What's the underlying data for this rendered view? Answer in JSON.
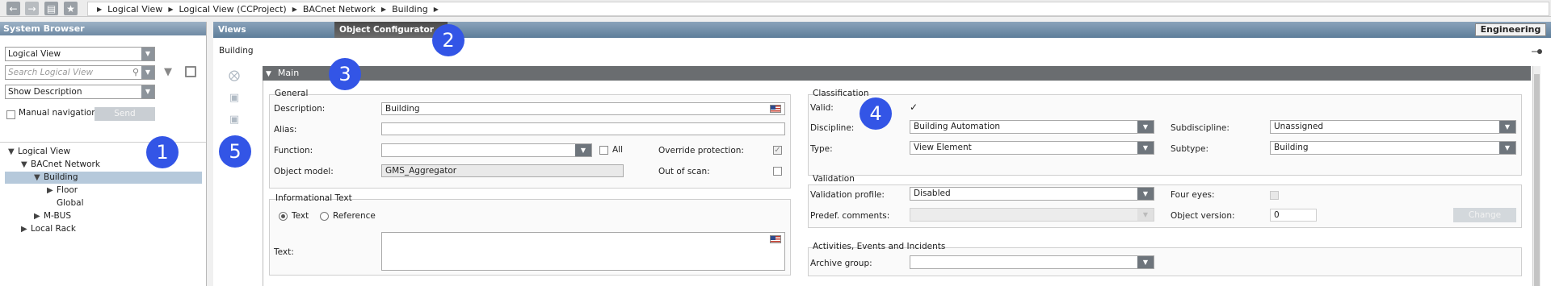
{
  "nav": {
    "back_icon": "arrow-left-icon",
    "forward_icon": "arrow-right-icon",
    "history_icon": "history-icon",
    "favorite_icon": "star-icon"
  },
  "breadcrumb": [
    "Logical View",
    "Logical View (CCProject)",
    "BACnet  Network",
    "Building"
  ],
  "system_browser": {
    "title": "System Browser",
    "view_select": "Logical View",
    "search_placeholder": "Search Logical View",
    "description_select": "Show Description",
    "manual_navigation_label": "Manual navigation",
    "send_label": "Send",
    "tree": [
      {
        "label": "Logical View",
        "expanded": true
      },
      {
        "label": "BACnet  Network",
        "expanded": true
      },
      {
        "label": "Building",
        "expanded": true,
        "selected": true
      },
      {
        "label": "Floor",
        "expanded": false
      },
      {
        "label": "Global"
      },
      {
        "label": "M-BUS",
        "expanded": false
      },
      {
        "label": "Local  Rack",
        "expanded": false
      }
    ]
  },
  "tabs": {
    "views": "Views",
    "object_configurator": "Object Configurator",
    "engineering": "Engineering"
  },
  "object_name": "Building",
  "main": {
    "header": "Main",
    "general": {
      "title": "General",
      "description_label": "Description:",
      "description_value": "Building",
      "alias_label": "Alias:",
      "alias_value": "",
      "function_label": "Function:",
      "function_value": "",
      "all_label": "All",
      "override_label": "Override protection:",
      "object_model_label": "Object model:",
      "object_model_value": "GMS_Aggregator",
      "out_of_scan_label": "Out of scan:"
    },
    "info_text": {
      "title": "Informational Text",
      "text_radio": "Text",
      "reference_radio": "Reference",
      "text_label": "Text:"
    },
    "classification": {
      "title": "Classification",
      "valid_label": "Valid:",
      "discipline_label": "Discipline:",
      "discipline_value": "Building Automation",
      "subdiscipline_label": "Subdiscipline:",
      "subdiscipline_value": "Unassigned",
      "type_label": "Type:",
      "type_value": "View Element",
      "subtype_label": "Subtype:",
      "subtype_value": "Building"
    },
    "validation": {
      "title": "Validation",
      "profile_label": "Validation profile:",
      "profile_value": "Disabled",
      "four_eyes_label": "Four eyes:",
      "predef_label": "Predef. comments:",
      "object_version_label": "Object version:",
      "object_version_value": "0",
      "change_label": "Change"
    },
    "activities": {
      "title": "Activities, Events and Incidents",
      "archive_label": "Archive group:"
    }
  },
  "markers": [
    "1",
    "2",
    "3",
    "4",
    "5"
  ],
  "colors": {
    "marker": "#3355e6",
    "tab_active": "#4a4a4a",
    "header": "#6a6d70"
  }
}
